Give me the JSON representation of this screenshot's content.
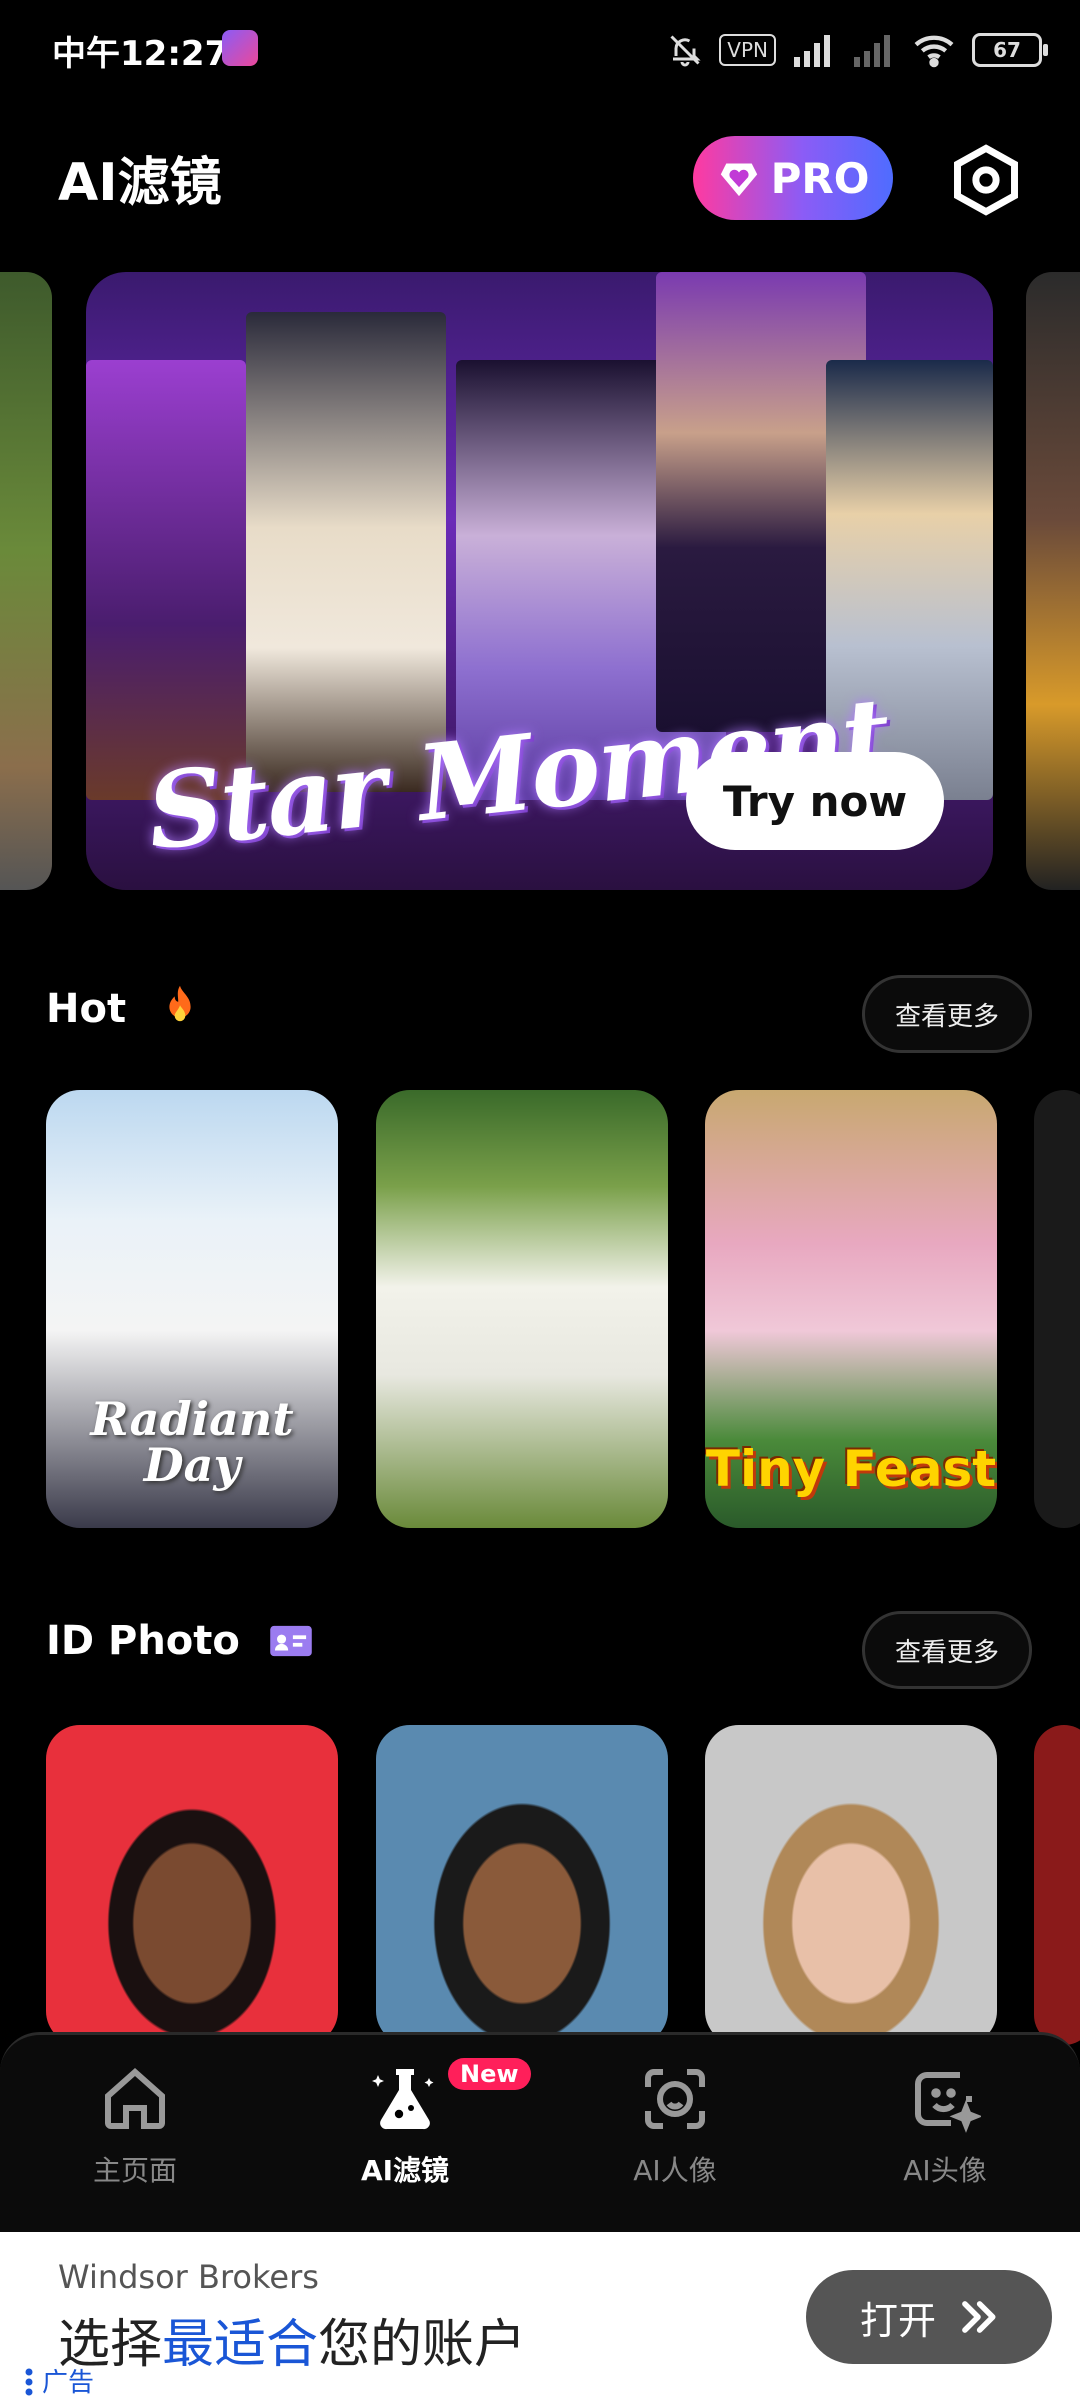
{
  "status_bar": {
    "time": "中午12:27",
    "vpn": "VPN",
    "battery": "67"
  },
  "header": {
    "title": "AI滤镜",
    "pro_label": "PRO"
  },
  "banner": {
    "title": "Star Moment",
    "cta": "Try now"
  },
  "sections": {
    "hot": {
      "title": "Hot",
      "see_more": "查看更多",
      "cards": [
        "Radiant Day",
        "",
        "Tiny Feast"
      ]
    },
    "id_photo": {
      "title": "ID Photo",
      "see_more": "查看更多"
    }
  },
  "nav": {
    "items": [
      {
        "label": "主页面",
        "icon": "home-icon"
      },
      {
        "label": "AI滤镜",
        "icon": "flask-icon"
      },
      {
        "label": "AI人像",
        "icon": "face-scan-icon"
      },
      {
        "label": "AI头像",
        "icon": "smiley-sparkle-icon"
      }
    ],
    "new_badge": "New"
  },
  "ad": {
    "brand": "Windsor Brokers",
    "headline_pre": "选择",
    "headline_highlight": "最适合",
    "headline_post": "您的账户",
    "button": "打开",
    "label": "广告"
  },
  "colors": {
    "accent_pink": "#ff3aa0",
    "accent_purple": "#8b5cf6",
    "new_badge": "#ff1f5a",
    "ad_highlight": "#1a56d6"
  }
}
